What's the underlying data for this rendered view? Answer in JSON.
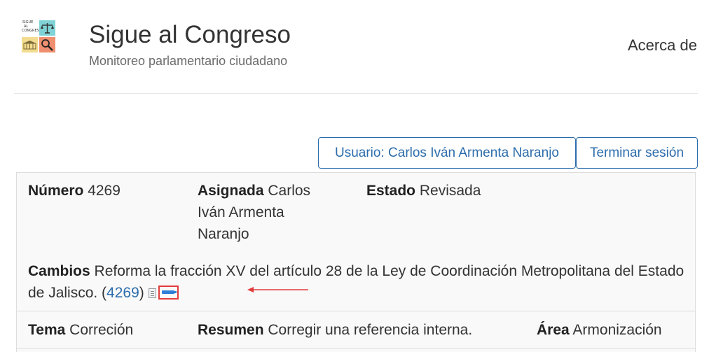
{
  "site": {
    "title": "Sigue al Congreso",
    "subtitle": "Monitoreo parlamentario ciudadano",
    "logo_text": [
      "SIGUE",
      "AL",
      "CONGRESO"
    ],
    "nav_about": "Acerca de"
  },
  "session": {
    "user_button": "Usuario: Carlos Iván Armenta Naranjo",
    "logout_button": "Terminar sesión"
  },
  "record": {
    "numero_label": "Número",
    "numero_value": "4269",
    "asignada_label": "Asignada",
    "asignada_value": "Carlos Iván Armenta Naranjo",
    "estado_label": "Estado",
    "estado_value": "Revisada",
    "cambios_label": "Cambios",
    "cambios_value": "Reforma la fracción XV del artículo 28 de la Ley de Coordinación Metropolitana del Estado de Jalisco.",
    "cambios_link": "4269",
    "tema_label": "Tema",
    "tema_value": "Correción",
    "resumen_label": "Resumen",
    "resumen_value": "Corregir una referencia interna.",
    "area_label": "Área",
    "area_value": "Armonización"
  },
  "colors": {
    "link": "#2c6cac",
    "annotation": "#e23b3b",
    "edit_icon": "#2d7fd6"
  }
}
